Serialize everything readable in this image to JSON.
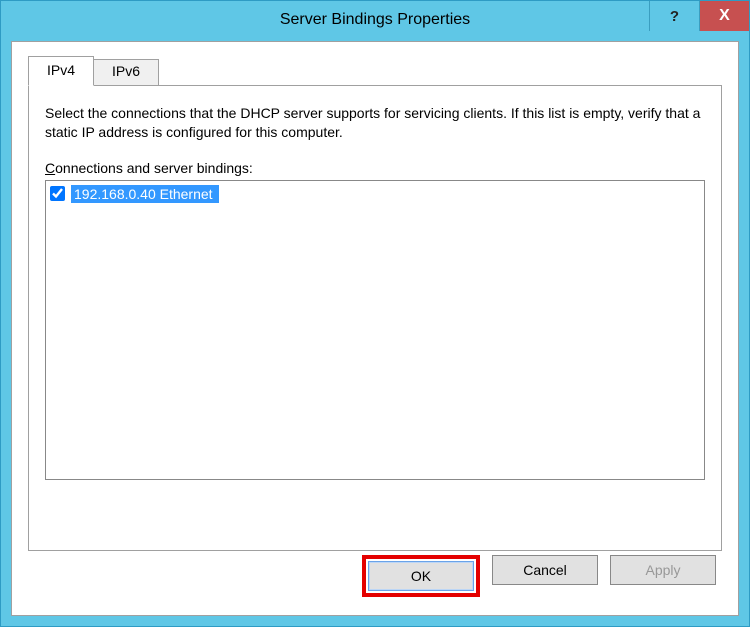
{
  "title": "Server Bindings Properties",
  "titlebar": {
    "help_symbol": "?",
    "close_symbol": "X"
  },
  "tabs": [
    {
      "label": "IPv4",
      "active": true
    },
    {
      "label": "IPv6",
      "active": false
    }
  ],
  "panel": {
    "instruction": "Select the connections that the DHCP server supports for servicing clients. If this list is empty, verify that a static IP address is configured for this computer.",
    "list_label_prefix": "C",
    "list_label_rest": "onnections and server bindings:",
    "items": [
      {
        "checked": true,
        "text": "192.168.0.40    Ethernet",
        "selected": true
      }
    ]
  },
  "buttons": {
    "ok": "OK",
    "cancel": "Cancel",
    "apply": "Apply"
  }
}
